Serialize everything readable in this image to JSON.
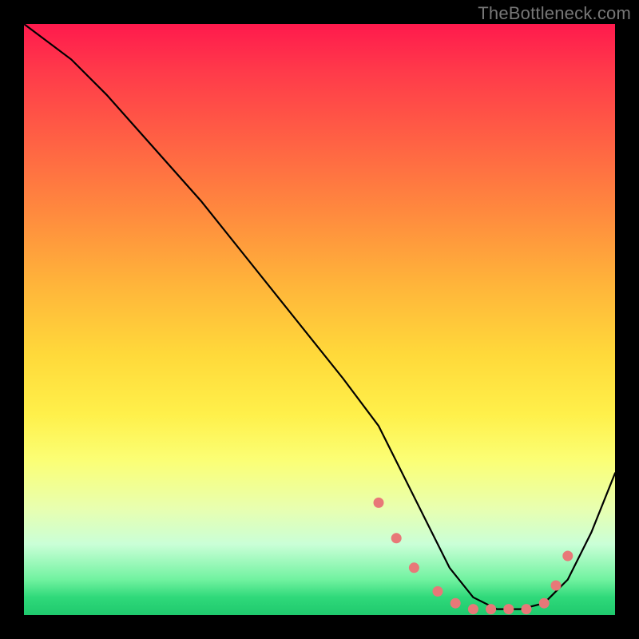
{
  "watermark": "TheBottleneck.com",
  "chart_data": {
    "type": "line",
    "title": "",
    "xlabel": "",
    "ylabel": "",
    "xlim": [
      0,
      100
    ],
    "ylim": [
      0,
      100
    ],
    "series": [
      {
        "name": "bottleneck-curve",
        "x": [
          0,
          8,
          14,
          22,
          30,
          38,
          46,
          54,
          60,
          64,
          68,
          72,
          76,
          80,
          84,
          88,
          92,
          96,
          100
        ],
        "values": [
          100,
          94,
          88,
          79,
          70,
          60,
          50,
          40,
          32,
          24,
          16,
          8,
          3,
          1,
          1,
          2,
          6,
          14,
          24
        ]
      }
    ],
    "markers": {
      "x": [
        60,
        63,
        66,
        70,
        73,
        76,
        79,
        82,
        85,
        88,
        90,
        92
      ],
      "values": [
        19,
        13,
        8,
        4,
        2,
        1,
        1,
        1,
        1,
        2,
        5,
        10
      ]
    },
    "background": "rainbow-heatmap-vertical"
  }
}
